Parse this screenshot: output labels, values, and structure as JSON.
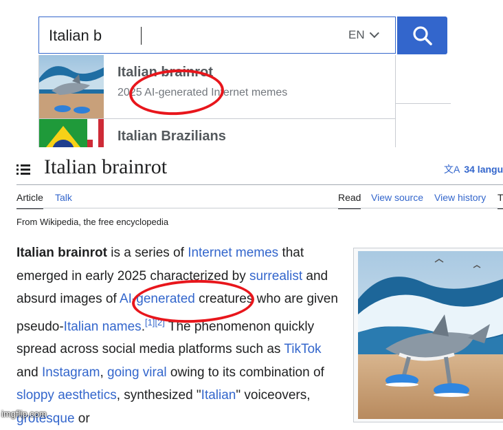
{
  "search": {
    "query": "Italian b",
    "language": "EN",
    "suggestions": [
      {
        "title": "Italian brainrot",
        "description": "2025 AI-generated Internet memes"
      },
      {
        "title": "Italian Brazilians",
        "description": ""
      }
    ]
  },
  "article": {
    "title": "Italian brainrot",
    "languages": "34 langua",
    "tabs_left": [
      "Article",
      "Talk"
    ],
    "tabs_right": [
      "Read",
      "View source",
      "View history",
      "T"
    ],
    "tagline": "From Wikipedia, the free encyclopedia",
    "lead": {
      "bold": "Italian brainrot",
      "t1": " is a series of ",
      "l1": "Internet memes",
      "t2": " that emerged in early 2025 characterized by ",
      "l2": "surrealist",
      "t3": " and absurd images of ",
      "l3": "AI-generated",
      "t4": " creatures who are given pseudo-",
      "l4": "Italian names",
      "t5": ".",
      "ref1": "[1]",
      "ref2": "[2]",
      "t6": " The phenomenon quickly spread across social media platforms such as ",
      "l5": "TikTok",
      "t7": " and ",
      "l6": "Instagram",
      "t8": ", ",
      "l7": "going viral",
      "t9": " owing to its combination of ",
      "l8": "sloppy aesthetics",
      "t10": ", synthesized \"",
      "l9": "Italian",
      "t11": "\" voiceovers, ",
      "l10": "grotesque",
      "t12": " or"
    }
  },
  "watermark": "imgflip.com",
  "colors": {
    "link": "#3366cc",
    "annotation": "#e8161c",
    "text": "#202122"
  }
}
